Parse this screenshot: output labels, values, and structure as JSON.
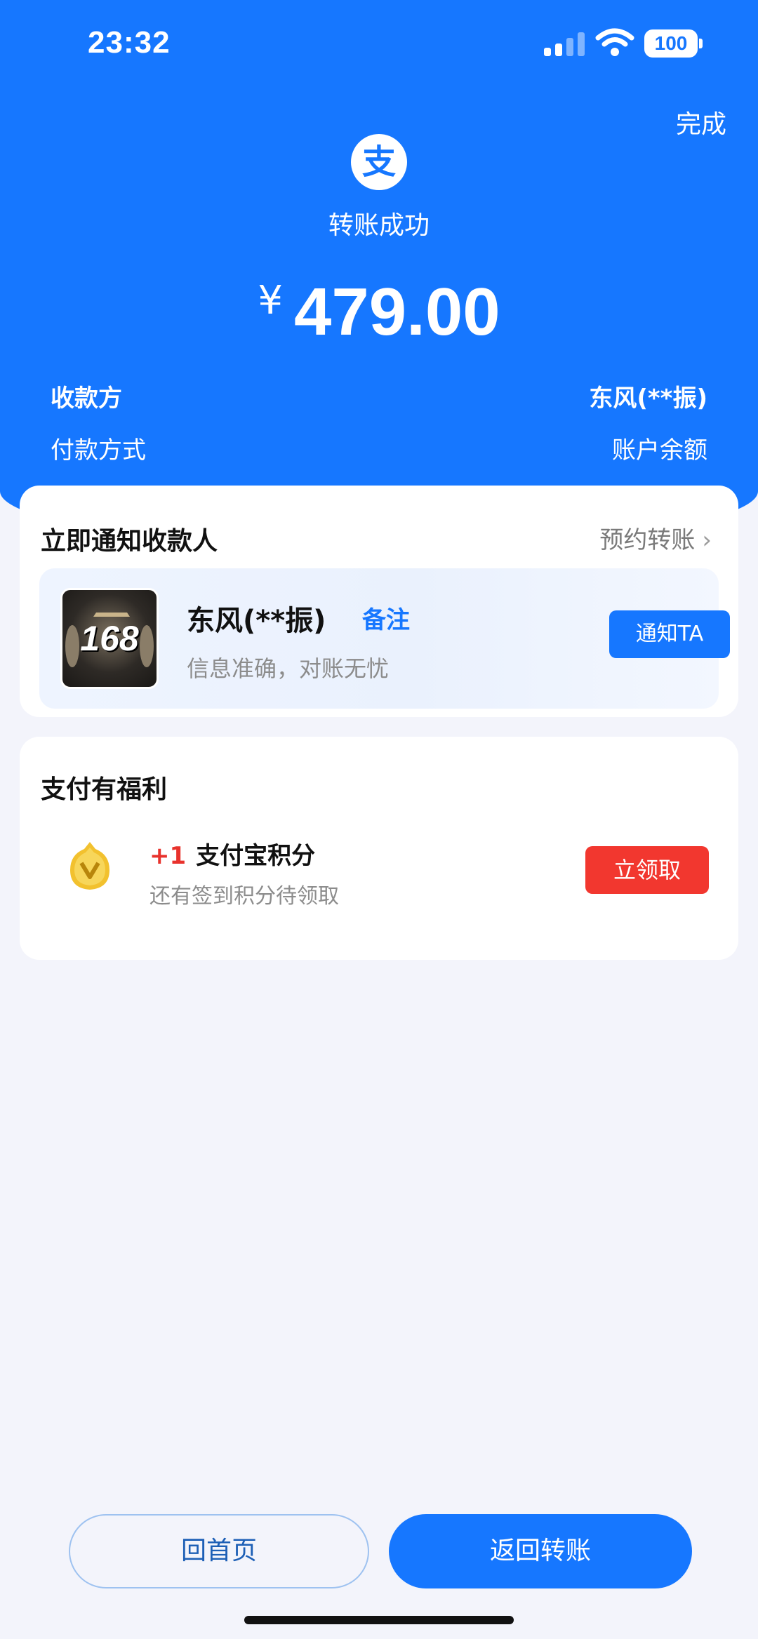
{
  "status_bar": {
    "time": "23:32",
    "battery": "100"
  },
  "header": {
    "done_label": "完成",
    "logo_char": "支",
    "status_text": "转账成功",
    "currency_symbol": "¥",
    "amount": "479.00"
  },
  "details": {
    "payee_label": "收款方",
    "payee_value": "东风(**振)",
    "payment_method_label": "付款方式",
    "payment_method_value": "账户余额"
  },
  "notify_card": {
    "title": "立即通知收款人",
    "schedule_link": "预约转账",
    "recipient_name": "东风(**振)",
    "remark_label": "备注",
    "subtitle": "信息准确，对账无忧",
    "notify_button": "通知TA",
    "avatar_text": "168"
  },
  "benefits_card": {
    "title": "支付有福利",
    "points_prefix": "+1",
    "points_title": "支付宝积分",
    "points_subtitle": "还有签到积分待领取",
    "claim_button": "立领取"
  },
  "footer": {
    "home_button": "回首页",
    "back_button": "返回转账"
  },
  "colors": {
    "primary": "#1677ff",
    "accent_red": "#f2372f",
    "background": "#f3f4fb"
  }
}
